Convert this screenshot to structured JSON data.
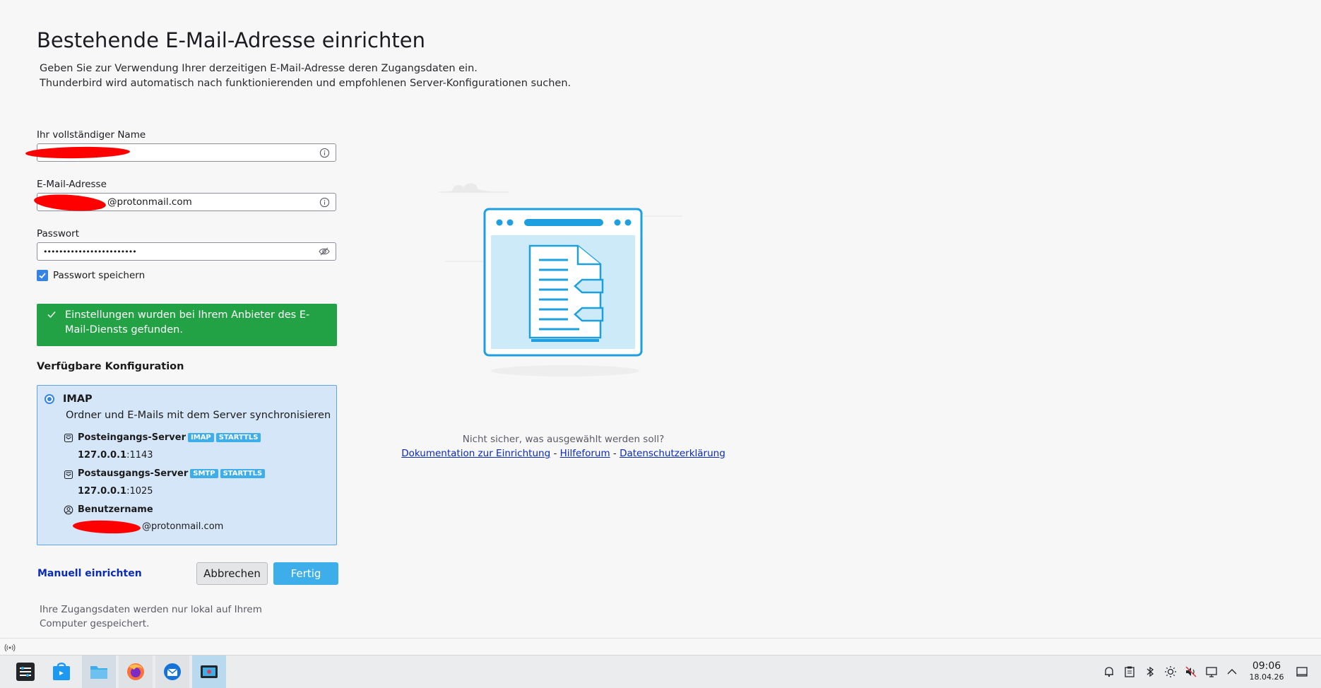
{
  "page": {
    "title": "Bestehende E-Mail-Adresse einrichten",
    "subtitle_line1": "Geben Sie zur Verwendung Ihrer derzeitigen E-Mail-Adresse deren Zugangsdaten ein.",
    "subtitle_line2": "Thunderbird wird automatisch nach funktionierenden und empfohlenen Server-Konfigurationen suchen."
  },
  "form": {
    "name_label": "Ihr vollständiger Name",
    "name_value": "",
    "email_label": "E-Mail-Adresse",
    "email_value": "@protonmail.com",
    "password_label": "Passwort",
    "password_value": "••••••••••••••••••••••••",
    "remember_label": "Passwort speichern",
    "remember_checked": true
  },
  "success_message": "Einstellungen wurden bei Ihrem Anbieter des E-Mail-Diensts gefunden.",
  "config": {
    "section_title": "Verfügbare Konfiguration",
    "protocol": "IMAP",
    "description": "Ordner und E-Mails mit dem Server synchronisieren",
    "incoming_label": "Posteingangs-Server",
    "incoming_badges": [
      "IMAP",
      "STARTTLS"
    ],
    "incoming_host": "127.0.0.1",
    "incoming_port": ":1143",
    "outgoing_label": "Postausgangs-Server",
    "outgoing_badges": [
      "SMTP",
      "STARTTLS"
    ],
    "outgoing_host": "127.0.0.1",
    "outgoing_port": ":1025",
    "username_label": "Benutzername",
    "username_value": "@protonmail.com"
  },
  "actions": {
    "manual": "Manuell einrichten",
    "cancel": "Abbrechen",
    "done": "Fertig"
  },
  "footer_note": "Ihre Zugangsdaten werden nur lokal auf Ihrem Computer gespeichert.",
  "help": {
    "question": "Nicht sicher, was ausgewählt werden soll?",
    "doc_link": "Dokumentation zur Einrichtung",
    "sep": "-",
    "forum_link": "Hilfeforum",
    "privacy_link": "Datenschutzerklärung"
  },
  "taskbar": {
    "clock": "09:06",
    "date": "18.04.26"
  },
  "colors": {
    "accent": "#3daee9",
    "success": "#23a245",
    "link": "#0b2bb8"
  }
}
